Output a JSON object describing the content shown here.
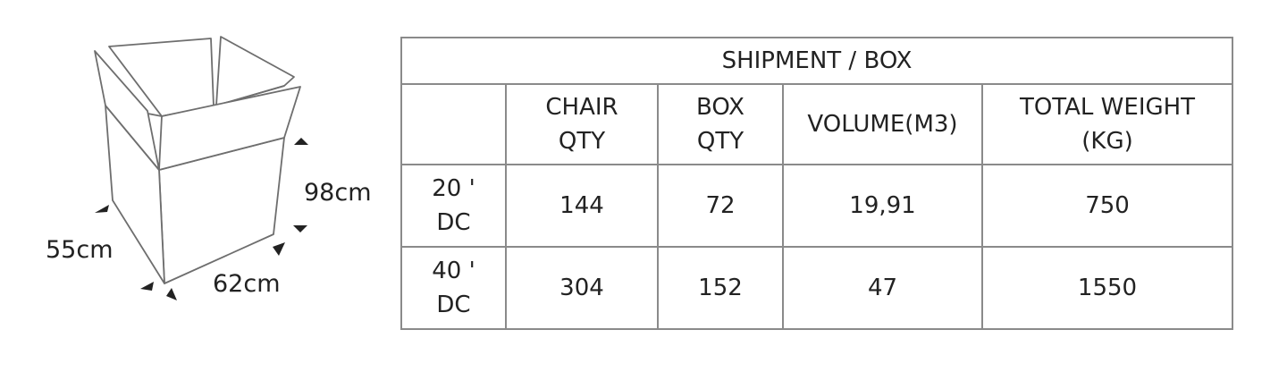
{
  "dimensions": {
    "height": "98cm",
    "depth": "55cm",
    "width": "62cm"
  },
  "table": {
    "title": "SHIPMENT / BOX",
    "headers": [
      {
        "line1": "CHAIR",
        "line2": "QTY"
      },
      {
        "line1": "BOX",
        "line2": "QTY"
      },
      {
        "line1": "VOLUME(M3)",
        "line2": ""
      },
      {
        "line1": "TOTAL WEIGHT",
        "line2": "(KG)"
      }
    ],
    "rows": [
      {
        "container_line1": "20 '",
        "container_line2": "DC",
        "chair_qty": "144",
        "box_qty": "72",
        "volume": "19,91",
        "weight": "750"
      },
      {
        "container_line1": "40 '",
        "container_line2": "DC",
        "chair_qty": "304",
        "box_qty": "152",
        "volume": "47",
        "weight": "1550"
      }
    ]
  }
}
